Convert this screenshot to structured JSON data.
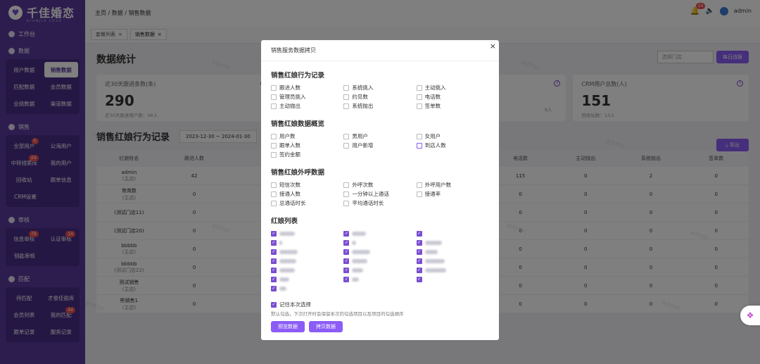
{
  "brand": {
    "name": "千佳婚恋",
    "tagline": "QIANJIA LOVE",
    "logo_icon": "heart-icon"
  },
  "sidebar": {
    "sections": [
      {
        "label": "工作台",
        "icon": "dashboard-icon"
      },
      {
        "label": "数据",
        "icon": "data-icon",
        "items": [
          {
            "label": "用户数据",
            "active": false
          },
          {
            "label": "销售数据",
            "active": true
          },
          {
            "label": "匹配数据",
            "active": false
          },
          {
            "label": "会员数据",
            "active": false
          },
          {
            "label": "业绩数据",
            "active": false
          },
          {
            "label": "渠道数据",
            "active": false
          }
        ]
      },
      {
        "label": "销售",
        "icon": "sales-icon",
        "items": [
          {
            "label": "全部用户",
            "badge": "5"
          },
          {
            "label": "公海用户"
          },
          {
            "label": "中转线索库",
            "badge": "24"
          },
          {
            "label": "我的用户"
          },
          {
            "label": "回收站"
          },
          {
            "label": "跟单信息"
          },
          {
            "label": "CRM设置"
          }
        ]
      },
      {
        "label": "审核",
        "icon": "audit-icon",
        "items": [
          {
            "label": "信息审核",
            "badge": "79"
          },
          {
            "label": "认证审核",
            "badge": "14"
          },
          {
            "label": "钥匙审核"
          }
        ]
      },
      {
        "label": "匹配",
        "icon": "match-icon",
        "items": [
          {
            "label": "待匹配"
          },
          {
            "label": "才俊佳丽库"
          },
          {
            "label": "会员列表"
          },
          {
            "label": "我的匹配",
            "badge": "44"
          },
          {
            "label": "跟单记录"
          },
          {
            "label": "服务记录"
          }
        ]
      }
    ]
  },
  "topbar": {
    "breadcrumb": [
      "主页",
      "数据",
      "销售数据"
    ],
    "notification_count": "24",
    "user": "admin"
  },
  "tabs": [
    {
      "label": "套餐列表",
      "close": "×"
    },
    {
      "label": "销售数据",
      "close": "×"
    }
  ],
  "page": {
    "title": "数据统计",
    "store_select_placeholder": "选择门店",
    "daily_report_button": "每日战报",
    "cards": [
      {
        "title": "近30天跟进条数(条)",
        "value": "290",
        "sub": "近30天跟进用户数：48人"
      },
      {
        "title": "",
        "value": "",
        "sub": "9人"
      },
      {
        "title": "CRM用户总数(人)",
        "value": "151",
        "sub": "回收站数：13人"
      }
    ],
    "section_title": "销售红娘行为记录",
    "date_range": "2023-12-30  ~  2024-01-30",
    "export_button": "导出",
    "table": {
      "headers": [
        "红娘姓名",
        "跟进人数",
        "",
        "",
        "",
        "",
        "电话数",
        "主动抛出",
        "系统抛出",
        "签单数"
      ],
      "rows": [
        {
          "name": "admin",
          "store": "(主店)",
          "c1": "42",
          "c6": "115",
          "c7": "0",
          "c8": "2",
          "c9": "0"
        },
        {
          "name": "育商数",
          "store": "(主店)",
          "c1": "0",
          "c6": "0",
          "c7": "0",
          "c8": "0",
          "c9": "0"
        },
        {
          "name": "(测试门店11)",
          "store": "",
          "c1": "0",
          "c6": "0",
          "c7": "0",
          "c8": "0",
          "c9": "0"
        },
        {
          "name": "(测试门店20)",
          "store": "",
          "c1": "0",
          "c6": "0",
          "c7": "0",
          "c8": "0",
          "c9": "0"
        },
        {
          "name": "bbbbb",
          "store": "(主店)",
          "c1": "0",
          "c6": "0",
          "c7": "0",
          "c8": "0",
          "c9": "0"
        },
        {
          "name": "bbbbb",
          "store": "(测试门店22)",
          "c1": "0",
          "c6": "0",
          "c7": "0",
          "c8": "0",
          "c9": "0"
        },
        {
          "name": "测试销售",
          "store": "(主店)",
          "c1": "0",
          "c6": "0",
          "c7": "0",
          "c8": "0",
          "c9": "0"
        },
        {
          "name": "熊销售1",
          "store": "(主店)",
          "c1": "0",
          "c6": "0",
          "c7": "0",
          "c8": "0",
          "c9": "0"
        }
      ]
    }
  },
  "modal": {
    "title": "销售服务数据拷贝",
    "close": "×",
    "groups": [
      {
        "title": "销售红娘行为记录",
        "items": [
          "跟进人数",
          "系统挑入",
          "主动挑入",
          "管理员挑入",
          "约见数",
          "电话数",
          "主动抛出",
          "系统抛出",
          "签单数"
        ]
      },
      {
        "title": "销售红娘数据概览",
        "items": [
          "用户数",
          "男用户",
          "女用户",
          "跟单人数",
          "用户新增",
          "到店人数",
          "签约金额"
        ]
      },
      {
        "title": "销售红娘外呼数据",
        "items": [
          "短信次数",
          "外呼次数",
          "外呼用户数",
          "接通人数",
          "一分钟以上通话",
          "接通率",
          "总通话时长",
          "平均通话时长"
        ]
      }
    ],
    "list_title": "红娘列表",
    "remember_label": "记住本次选择",
    "hint": "默认勾选，下次打开时会保留本次的勾选项目以及项目的勾选顺序",
    "preview_button": "预览数据",
    "copy_button": "拷贝数据"
  },
  "watermark": "admin",
  "colors": {
    "sidebar": "#5a3a9e",
    "accent": "#8b5cf6",
    "badge": "#f05050"
  }
}
